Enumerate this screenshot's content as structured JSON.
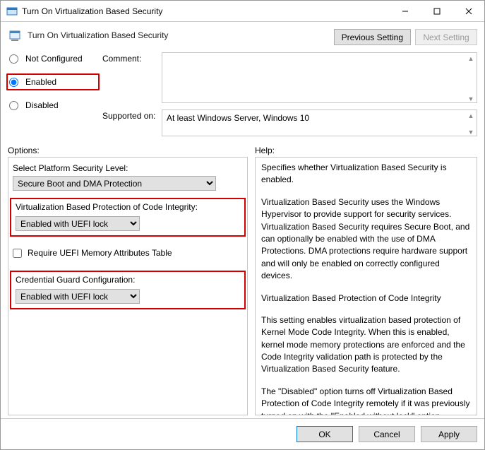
{
  "window": {
    "title": "Turn On Virtualization Based Security"
  },
  "header": {
    "policy_name": "Turn On Virtualization Based Security",
    "prev_button": "Previous Setting",
    "next_button": "Next Setting"
  },
  "state": {
    "not_configured_label": "Not Configured",
    "enabled_label": "Enabled",
    "disabled_label": "Disabled",
    "comment_label": "Comment:",
    "comment_value": "",
    "supported_label": "Supported on:",
    "supported_value": "At least Windows Server, Windows 10"
  },
  "labels": {
    "options": "Options:",
    "help": "Help:"
  },
  "options": {
    "platform_label": "Select Platform Security Level:",
    "platform_value": "Secure Boot and DMA Protection",
    "vbpci_label": "Virtualization Based Protection of Code Integrity:",
    "vbpci_value": "Enabled with UEFI lock",
    "uefi_checkbox": "Require UEFI Memory Attributes Table",
    "credguard_label": "Credential Guard Configuration:",
    "credguard_value": "Enabled with UEFI lock"
  },
  "help": {
    "p1": "Specifies whether Virtualization Based Security is enabled.",
    "p2": "Virtualization Based Security uses the Windows Hypervisor to provide support for security services. Virtualization Based Security requires Secure Boot, and can optionally be enabled with the use of DMA Protections. DMA protections require hardware support and will only be enabled on correctly configured devices.",
    "p3": "Virtualization Based Protection of Code Integrity",
    "p4": "This setting enables virtualization based protection of Kernel Mode Code Integrity. When this is enabled, kernel mode memory protections are enforced and the Code Integrity validation path is protected by the Virtualization Based Security feature.",
    "p5": "The \"Disabled\" option turns off Virtualization Based Protection of Code Integrity remotely if it was previously turned on with the \"Enabled without lock\" option."
  },
  "footer": {
    "ok": "OK",
    "cancel": "Cancel",
    "apply": "Apply"
  }
}
